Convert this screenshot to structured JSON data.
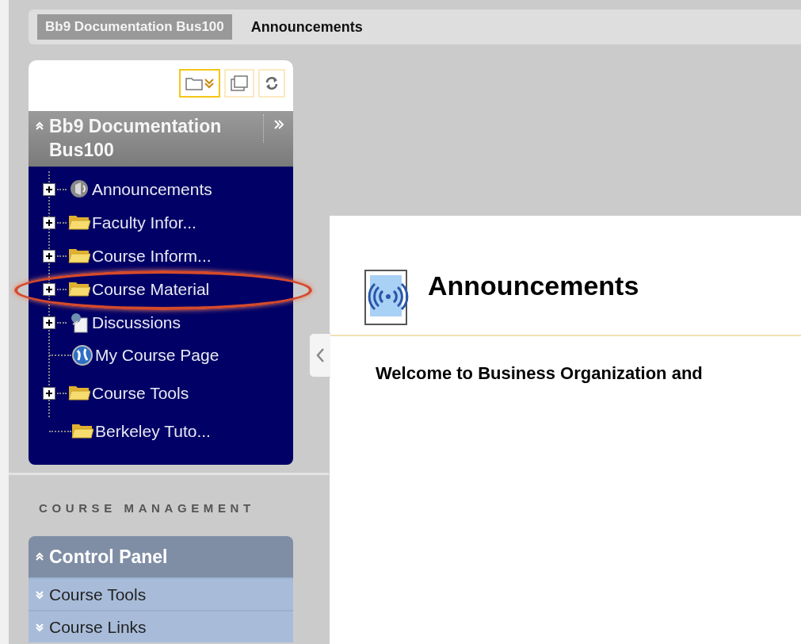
{
  "breadcrumbs": [
    {
      "label": "Bb9 Documentation Bus100",
      "current": false
    },
    {
      "label": "Announcements",
      "current": true
    }
  ],
  "course_menu": {
    "title": "Bb9 Documentation Bus100",
    "expanded": true,
    "items": [
      {
        "label": "Announcements",
        "kind": "announcement",
        "expandable": true,
        "highlighted": false
      },
      {
        "label": "Faculty Infor...",
        "kind": "folder",
        "expandable": true,
        "highlighted": false
      },
      {
        "label": "Course Inform...",
        "kind": "folder",
        "expandable": true,
        "highlighted": false
      },
      {
        "label": "Course Material",
        "kind": "folder",
        "expandable": true,
        "highlighted": true
      },
      {
        "label": "Discussions",
        "kind": "discussion",
        "expandable": true,
        "highlighted": false
      },
      {
        "label": "My Course Page",
        "kind": "globe",
        "expandable": false,
        "highlighted": false
      },
      {
        "label": "Course Tools",
        "kind": "folder",
        "expandable": true,
        "highlighted": false
      },
      {
        "label": "Berkeley Tuto...",
        "kind": "folder",
        "expandable": false,
        "highlighted": false
      }
    ]
  },
  "course_management": {
    "heading": "COURSE MANAGEMENT",
    "control_panel": {
      "title": "Control Panel",
      "expanded": true,
      "items": [
        {
          "label": "Course Tools",
          "expanded": false
        },
        {
          "label": "Course Links",
          "expanded": false
        }
      ]
    }
  },
  "content": {
    "title": "Announcements",
    "text": "Welcome to Business Organization and"
  }
}
